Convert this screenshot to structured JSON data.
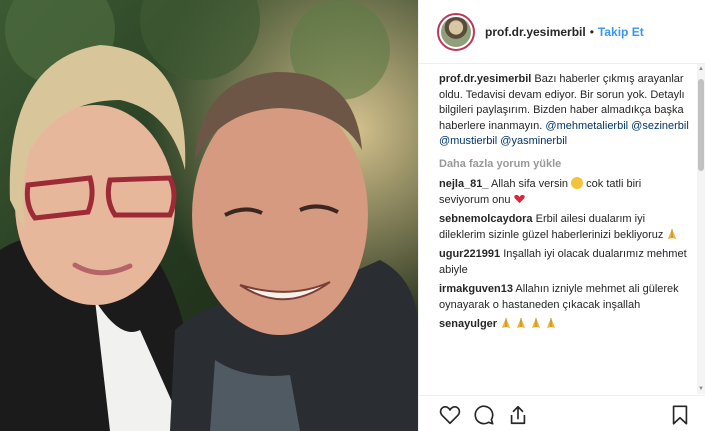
{
  "header": {
    "username": "prof.dr.yesimerbil",
    "separator": "•",
    "follow_label": "Takip Et"
  },
  "caption": {
    "username": "prof.dr.yesimerbil",
    "text": " Bazı haberler çıkmış arayanlar oldu. Tedavisi devam ediyor. Bir sorun yok. Detaylı bilgileri paylaşırım. Bizden haber almadıkça başka haberlere inanmayın. ",
    "mentions": [
      "@mehmetalierbil",
      "@sezinerbil",
      "@mustierbil",
      "@yasminerbil"
    ]
  },
  "load_more": "Daha fazla yorum yükle",
  "comments": [
    {
      "user": "nejla_81_",
      "text_before": " Allah sifa versin ",
      "text_after": " cok tatli biri seviyorum onu ",
      "emoji": [
        "smiling-face-icon",
        "heart-icon"
      ]
    },
    {
      "user": "sebnemolcaydora",
      "text": " Erbil ailesi dualarım iyi dileklerim sizinle güzel haberlerinizi bekliyoruz ",
      "emoji": [
        "praying-hands-icon"
      ]
    },
    {
      "user": "ugur221991",
      "text": " Inşallah iyi olacak dualarımız mehmet abiyle"
    },
    {
      "user": "irmakguven13",
      "text": " Allahın izniyle mehmet ali gülerek oynayarak o hastaneden çıkacak inşallah"
    },
    {
      "user": "senayulger",
      "text": " ",
      "emoji": [
        "praying-hands-icon",
        "praying-hands-icon",
        "praying-hands-icon",
        "praying-hands-icon"
      ]
    }
  ],
  "actions": [
    "like-icon",
    "comment-icon",
    "share-icon",
    "bookmark-icon"
  ],
  "colors": {
    "link": "#3897f0",
    "mention": "#003569",
    "muted": "#999999",
    "text": "#262626"
  }
}
